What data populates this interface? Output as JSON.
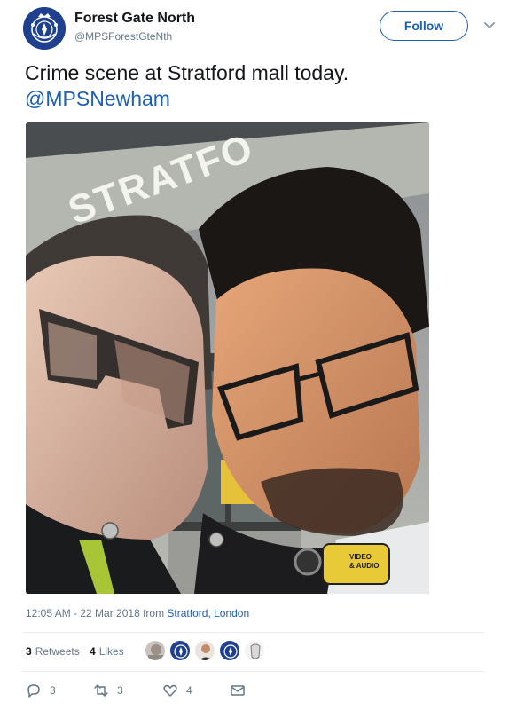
{
  "account": {
    "name": "Forest Gate North",
    "handle": "@MPSForestGteNth"
  },
  "follow_label": "Follow",
  "tweet": {
    "text": "Crime scene at Stratford mall today.",
    "mention": "@MPSNewham"
  },
  "photo": {
    "sign_text": "STRATFO",
    "camera_label_1": "VIDEO",
    "camera_label_2": "& AUDIO"
  },
  "meta": {
    "time": "12:05 AM - 22 Mar 2018 from ",
    "location": "Stratford, London"
  },
  "stats": {
    "retweets_count": "3",
    "retweets_label": "Retweets",
    "likes_count": "4",
    "likes_label": "Likes"
  },
  "actions": {
    "reply_count": "3",
    "retweet_count": "3",
    "like_count": "4"
  },
  "colors": {
    "link": "#1b5fb8",
    "muted": "#657786",
    "avatar_blue": "#1f3f8f"
  },
  "icons": [
    "police-crest-icon",
    "chevron-down-icon",
    "reply-icon",
    "retweet-icon",
    "heart-icon",
    "mail-icon"
  ]
}
